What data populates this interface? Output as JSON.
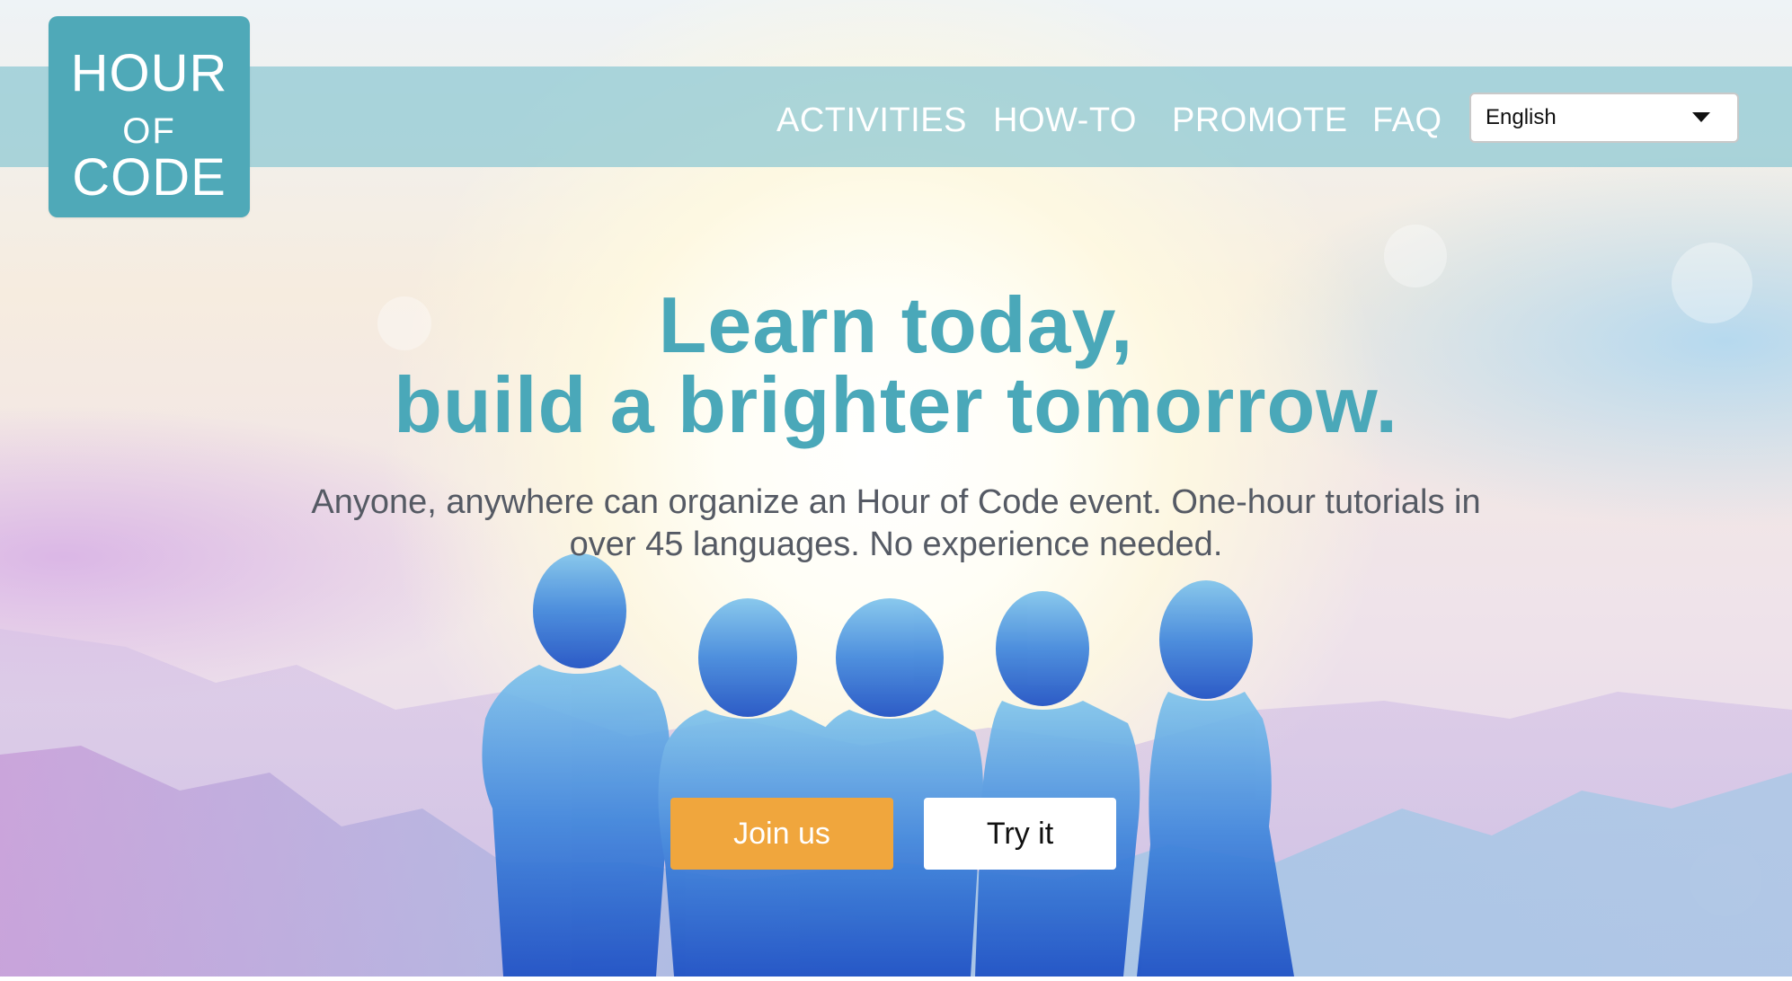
{
  "logo": {
    "line1": "HOUR",
    "line2": "OF",
    "line3": "CODE"
  },
  "nav": {
    "links": [
      "ACTIVITIES",
      "HOW-TO",
      "PROMOTE",
      "FAQ"
    ],
    "language": {
      "selected": "English"
    }
  },
  "hero": {
    "headline_line1": "Learn today,",
    "headline_line2": "build a brighter tomorrow.",
    "sub_line1": "Anyone, anywhere can organize an Hour of Code event. One-hour tutorials in",
    "sub_line2": "over 45 languages. No experience needed.",
    "join_label": "Join us",
    "try_label": "Try it"
  },
  "colors": {
    "brand_teal": "#4fa9b8",
    "headline_teal": "#4aa8b9",
    "join_orange": "#f0a63d",
    "nav_bar": "#8cc8d2"
  },
  "icons": {
    "language_dropdown": "chevron-down-icon"
  }
}
